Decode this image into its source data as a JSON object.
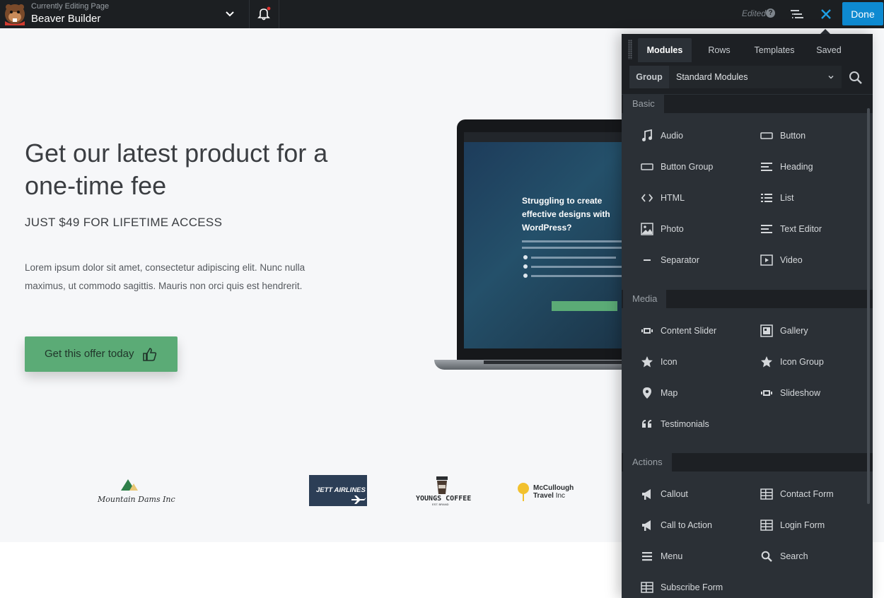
{
  "topbar": {
    "editing_label": "Currently Editing Page",
    "page_title": "Beaver Builder",
    "status": "Edited",
    "done_label": "Done",
    "notification_dot_color": "#e0322f",
    "accent_color": "#0e8ad1"
  },
  "hero": {
    "title": "Get our latest product for a one-time fee",
    "subtitle": "JUST $49 FOR LIFETIME ACCESS",
    "description": "Lorem ipsum dolor sit amet, consectetur adipiscing elit. Nunc nulla maximus, ut commodo sagittis. Mauris non orci quis est hendrerit.",
    "cta_label": "Get this offer today",
    "cta_color": "#5bab76"
  },
  "laptop_screen": {
    "headline": "Struggling to create effective designs with WordPress?"
  },
  "logos": {
    "mountain": "Mountain Dams Inc",
    "jett": "JETT AIRLINES",
    "coffee": "YOUNGS COFFEE",
    "coffee_sub": "EST. BRAND",
    "travel_line1": "McCullough",
    "travel_line2_bold": "Travel",
    "travel_line2_rest": " Inc"
  },
  "panel": {
    "tabs": [
      {
        "label": "Modules",
        "active": true
      },
      {
        "label": "Rows",
        "active": false
      },
      {
        "label": "Templates",
        "active": false
      },
      {
        "label": "Saved",
        "active": false
      }
    ],
    "group_label": "Group",
    "group_value": "Standard Modules",
    "sections": [
      {
        "name": "Basic",
        "modules": [
          {
            "label": "Audio",
            "icon": "music-note-icon"
          },
          {
            "label": "Button",
            "icon": "button-icon"
          },
          {
            "label": "Button Group",
            "icon": "button-group-icon"
          },
          {
            "label": "Heading",
            "icon": "heading-icon"
          },
          {
            "label": "HTML",
            "icon": "code-icon"
          },
          {
            "label": "List",
            "icon": "list-icon"
          },
          {
            "label": "Photo",
            "icon": "photo-icon"
          },
          {
            "label": "Text Editor",
            "icon": "text-editor-icon"
          },
          {
            "label": "Separator",
            "icon": "separator-icon"
          },
          {
            "label": "Video",
            "icon": "video-icon"
          }
        ]
      },
      {
        "name": "Media",
        "modules": [
          {
            "label": "Content Slider",
            "icon": "slider-icon"
          },
          {
            "label": "Gallery",
            "icon": "gallery-icon"
          },
          {
            "label": "Icon",
            "icon": "star-icon"
          },
          {
            "label": "Icon Group",
            "icon": "star-icon"
          },
          {
            "label": "Map",
            "icon": "map-pin-icon"
          },
          {
            "label": "Slideshow",
            "icon": "slider-icon"
          },
          {
            "label": "Testimonials",
            "icon": "quote-icon"
          }
        ]
      },
      {
        "name": "Actions",
        "modules": [
          {
            "label": "Callout",
            "icon": "megaphone-icon"
          },
          {
            "label": "Contact Form",
            "icon": "form-icon"
          },
          {
            "label": "Call to Action",
            "icon": "megaphone-icon"
          },
          {
            "label": "Login Form",
            "icon": "form-icon"
          },
          {
            "label": "Menu",
            "icon": "menu-icon"
          },
          {
            "label": "Search",
            "icon": "search-icon"
          },
          {
            "label": "Subscribe Form",
            "icon": "form-icon"
          }
        ]
      }
    ]
  }
}
